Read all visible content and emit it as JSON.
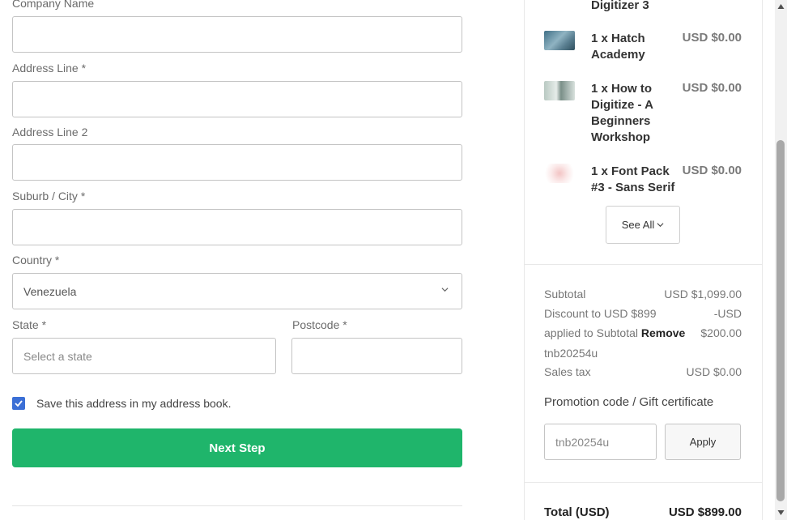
{
  "form": {
    "company_label": "Company Name",
    "address1_label": "Address Line *",
    "address2_label": "Address Line 2",
    "city_label": "Suburb / City *",
    "country_label": "Country *",
    "country_value": "Venezuela",
    "state_label": "State *",
    "state_placeholder": "Select a state",
    "postcode_label": "Postcode *",
    "save_address_label": "Save this address in my address book.",
    "save_address_checked": true,
    "next_step_label": "Next Step"
  },
  "order": {
    "items": [
      {
        "name": "Digitizer 3",
        "price": ""
      },
      {
        "name": "1 x Hatch Academy",
        "price": "USD $0.00"
      },
      {
        "name": "1 x How to Digitize - A Beginners Workshop",
        "price": "USD $0.00"
      },
      {
        "name": "1 x Font Pack #3 - Sans Serif",
        "price": "USD $0.00"
      }
    ],
    "see_all_label": "See All",
    "subtotal_label": "Subtotal",
    "subtotal_value": "USD $1,099.00",
    "discount_line1": "Discount to USD $899",
    "discount_line2": "applied to Subtotal",
    "discount_remove": "Remove",
    "discount_code": "tnb20254u",
    "discount_value_line1": "-USD",
    "discount_value_line2": "$200.00",
    "tax_label": "Sales tax",
    "tax_value": "USD $0.00",
    "promo_title": "Promotion code / Gift certificate",
    "promo_value": "tnb20254u",
    "apply_label": "Apply",
    "total_label": "Total (USD)",
    "total_value": "USD $899.00"
  },
  "colors": {
    "accent_green": "#1fb56b",
    "checkbox_blue": "#3b6fd6"
  }
}
